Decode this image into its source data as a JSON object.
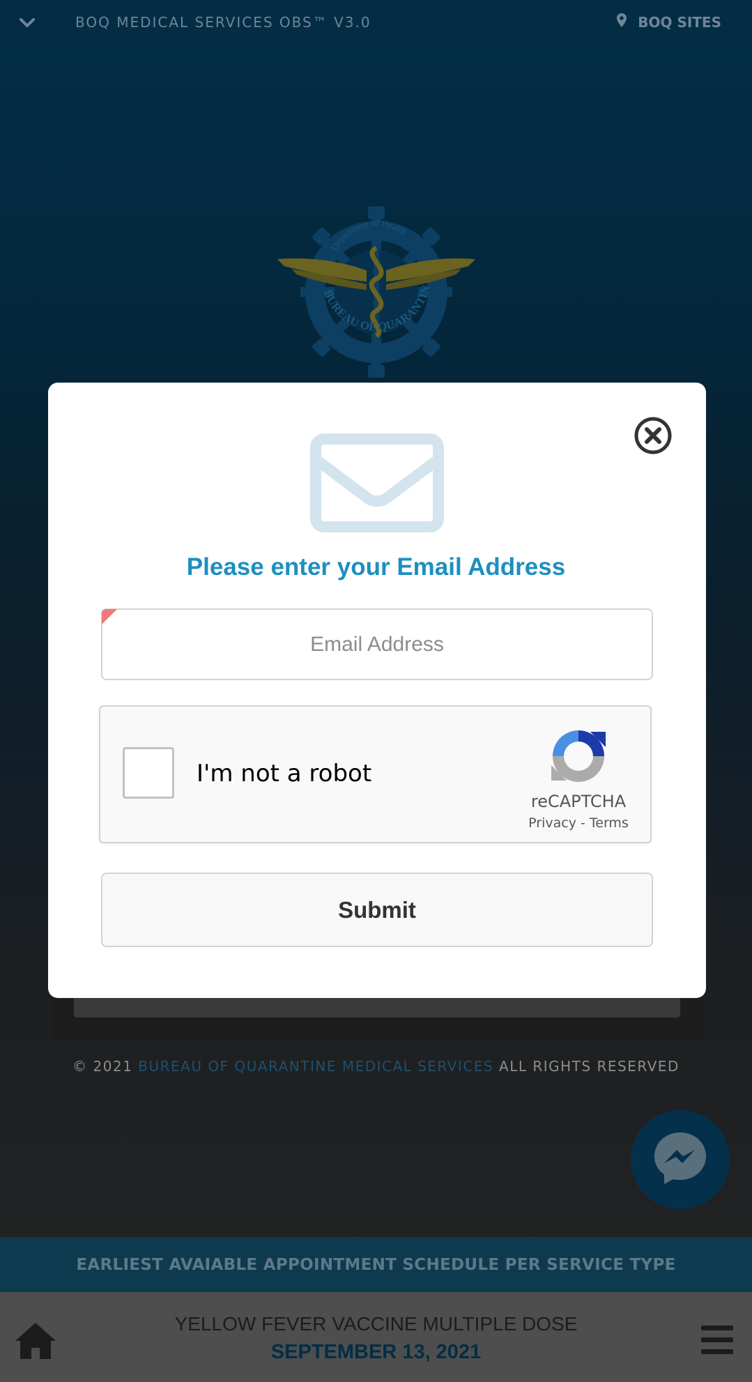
{
  "header": {
    "title": "BOQ MEDICAL SERVICES OBS™ V3.0",
    "sites_label": "BOQ SITES"
  },
  "logo": {
    "top_text": "Department of Health",
    "bottom_text": "BUREAU OF QUARANTINE"
  },
  "modal": {
    "title": "Please enter your Email Address",
    "email_placeholder": "Email Address",
    "captcha_label": "I'm not a robot",
    "captcha_brand": "reCAPTCHA",
    "captcha_privacy": "Privacy",
    "captcha_sep": " - ",
    "captcha_terms": "Terms",
    "submit_label": "Submit"
  },
  "footer": {
    "copyright_prefix": "© 2021 ",
    "org_name": "BUREAU OF QUARANTINE MEDICAL SERVICES",
    "copyright_suffix": " ALL RIGHTS RESERVED"
  },
  "banner": {
    "earliest_label": "EARLIEST AVAIABLE APPOINTMENT SCHEDULE PER SERVICE TYPE",
    "service_name": "YELLOW FEVER VACCINE MULTIPLE DOSE",
    "service_date": "SEPTEMBER 13, 2021"
  },
  "colors": {
    "primary_dark": "#032d45",
    "accent_blue": "#1d8fc0",
    "envelope": "#d3e4ee",
    "req_mark": "#f07a7a"
  },
  "icons": [
    "chevron-down-icon",
    "map-pin-icon",
    "close-icon",
    "envelope-icon",
    "recaptcha-icon",
    "messenger-icon",
    "home-icon",
    "menu-icon"
  ]
}
